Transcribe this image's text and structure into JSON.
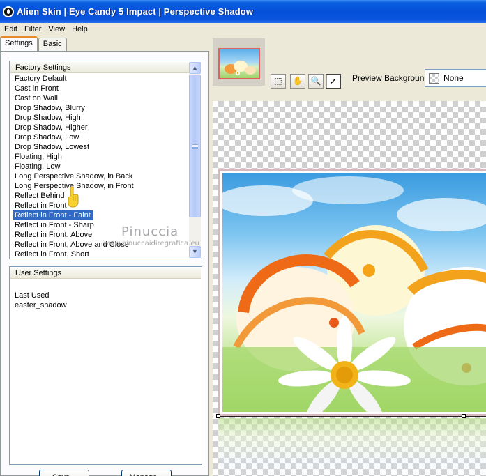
{
  "window": {
    "title": "Alien Skin | Eye Candy 5 Impact | Perspective Shadow"
  },
  "menu": [
    "Edit",
    "Filter",
    "View",
    "Help"
  ],
  "tabs": [
    {
      "label": "Settings",
      "active": true
    },
    {
      "label": "Basic",
      "active": false
    }
  ],
  "factory_settings": {
    "header": "Factory Settings",
    "items": [
      "Factory Default",
      "Cast in Front",
      "Cast on Wall",
      "Drop Shadow, Blurry",
      "Drop Shadow, High",
      "Drop Shadow, Higher",
      "Drop Shadow, Low",
      "Drop Shadow, Lowest",
      "Floating, High",
      "Floating, Low",
      "Long Perspective Shadow, in Back",
      "Long Perspective Shadow, in Front",
      "Reflect Behind",
      "Reflect in Front",
      "Reflect in Front - Faint",
      "Reflect in Front - Sharp",
      "Reflect in Front, Above",
      "Reflect in Front, Above and Close",
      "Reflect in Front, Short"
    ],
    "selected_index": 14
  },
  "user_settings": {
    "header": "User Settings",
    "items": [
      "Last Used",
      "easter_shadow"
    ]
  },
  "buttons": {
    "save": "Save...",
    "manage": "Manage..."
  },
  "watermark": {
    "name": "Pinuccia",
    "site": "www.pinuccaidiregrafica.eu"
  },
  "preview": {
    "background_label": "Preview Background:",
    "background_value": "None"
  },
  "colors": {
    "selection": "#316ac5",
    "title_bar": "#0550d8",
    "nav_border": "#e06060"
  }
}
